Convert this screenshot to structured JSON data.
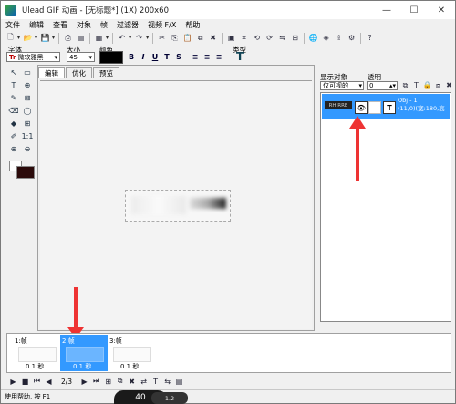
{
  "window": {
    "title": "Ulead GIF 动画 - [无标题*] (1X) 200x60",
    "buttons": [
      "—",
      "☐",
      "✕"
    ]
  },
  "menu": [
    "文件",
    "编辑",
    "查看",
    "对象",
    "帧",
    "过滤器",
    "视频 F/X",
    "帮助"
  ],
  "textbar": {
    "font_label": "字体",
    "font_value": "微软雅黑",
    "size_label": "大小",
    "size_value": "45",
    "color_label": "颜色",
    "color_value": "#000000",
    "type_label": "类型",
    "format_buttons": [
      "B",
      "I",
      "U",
      "T",
      "S"
    ]
  },
  "editor": {
    "tabs": [
      "编辑",
      "优化",
      "预览"
    ]
  },
  "right_panel": {
    "display_label": "显示对象",
    "display_value": "仅可视的",
    "opacity_label": "透明",
    "opacity_value": "0",
    "object": {
      "thumb_text": "RH·RRE",
      "line1": "Obj - 1",
      "line2": "(11,0)(宽:180,高"
    }
  },
  "frames": [
    {
      "label": "1:帧",
      "time": "0.1 秒",
      "selected": false
    },
    {
      "label": "2:帧",
      "time": "0.1 秒",
      "selected": true
    },
    {
      "label": "3:帧",
      "time": "0.1 秒",
      "selected": false
    }
  ],
  "playback": {
    "counter": "2/3"
  },
  "status": {
    "text": "使用帮助, 按 F1"
  },
  "overlay": {
    "big": "40",
    "small": "1.2"
  }
}
